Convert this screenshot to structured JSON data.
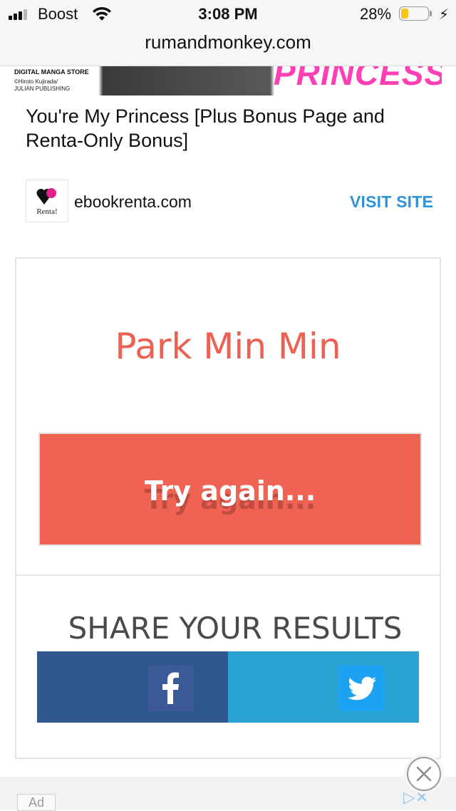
{
  "status_bar": {
    "carrier": "Boost",
    "time": "3:08 PM",
    "battery_percent": "28%",
    "battery_level": 0.28,
    "signal_bars_filled": 3,
    "signal_bars_total": 4
  },
  "browser": {
    "url": "rumandmonkey.com"
  },
  "banner": {
    "store_label": "DIGITAL MANGA STORE",
    "credit_line1": "©Hiroto Kujirada/",
    "credit_line2": "JULIAN PUBLISHING",
    "title_fragment": "PRINCESS"
  },
  "ad_card": {
    "headline": "You're My Princess [Plus Bonus Page and Renta-Only Bonus]",
    "logo_label": "Renta!",
    "domain": "ebookrenta.com",
    "cta": "VISIT SITE"
  },
  "quiz_result": {
    "name": "Park Min Min",
    "try_again": "Try again...",
    "share_title": "SHARE YOUR RESULTS"
  },
  "bottom_ad": {
    "label": "Ad"
  },
  "colors": {
    "result_accent": "#ec6153",
    "try_button": "#f06252",
    "facebook": "#30588f",
    "twitter": "#2aa3d2",
    "visit_site": "#2f93d6"
  },
  "icons": [
    "cellular-signal-icon",
    "wifi-icon",
    "battery-icon",
    "charging-bolt-icon",
    "facebook-icon",
    "twitter-icon",
    "close-icon",
    "adchoices-icon"
  ]
}
